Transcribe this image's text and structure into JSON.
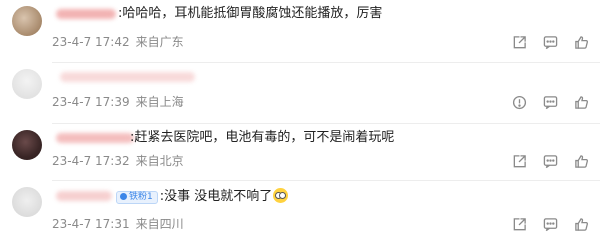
{
  "comments": [
    {
      "text": ":哈哈哈，耳机能抵御胃酸腐蚀还能播放，厉害",
      "date": "23-4-7 17:42",
      "location": "来自广东",
      "actions": [
        "share-icon",
        "comment-icon",
        "like-icon"
      ]
    },
    {
      "text": "",
      "date": "23-4-7 17:39",
      "location": "来自上海",
      "actions": [
        "report-icon",
        "comment-icon",
        "like-icon"
      ]
    },
    {
      "text": ":赶紧去医院吧，电池有毒的，可不是闹着玩呢",
      "date": "23-4-7 17:32",
      "location": "来自北京",
      "actions": [
        "share-icon",
        "comment-icon",
        "like-icon"
      ]
    },
    {
      "badge": "铁粉1",
      "text": ":没事 没电就不响了",
      "date": "23-4-7 17:31",
      "location": "来自四川",
      "actions": [
        "share-icon",
        "comment-icon",
        "like-icon"
      ]
    }
  ],
  "colors": {
    "meta_text": "#8a8a8a",
    "badge_blue": "#3c86e8",
    "divider": "#ededed",
    "icon_gray": "#8a8a8a"
  }
}
